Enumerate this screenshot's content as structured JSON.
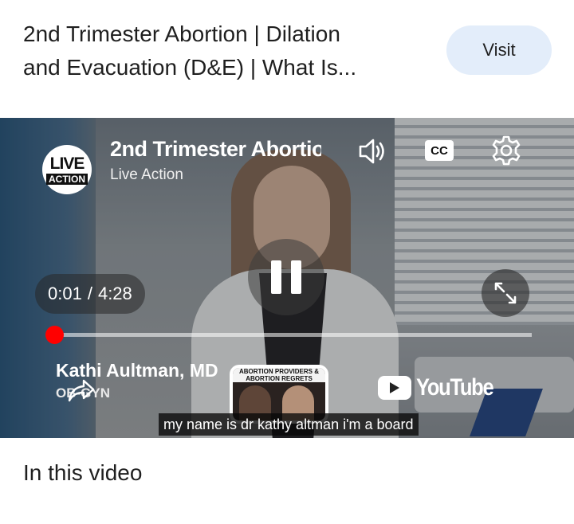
{
  "header": {
    "title": "2nd Trimester Abortion | Dilation\nand Evacuation (D&E) | What Is...",
    "visit_label": "Visit"
  },
  "player": {
    "video_title": "2nd Trimester Abortion",
    "channel_name": "Live Action",
    "channel_logo": {
      "line1": "LIVE",
      "line2": "ACTION"
    },
    "cc_label": "CC",
    "current_time": "0:01",
    "time_separator": "/",
    "duration": "4:28",
    "progress_fraction": 0.004,
    "lower_third": {
      "name": "Kathi Aultman, MD",
      "role": "OB-GYN"
    },
    "end_card_text": "ABORTION PROVIDERS & ABORTION REGRETS",
    "youtube_label": "YouTube",
    "caption": "my name is dr kathy altman i'm a board",
    "icons": [
      "sound-icon",
      "cc-icon",
      "settings-gear-icon",
      "pause-icon",
      "fullscreen-icon",
      "share-icon",
      "youtube-play-icon"
    ],
    "accent_color": "#ff0000"
  },
  "section": {
    "title": "In this video"
  }
}
